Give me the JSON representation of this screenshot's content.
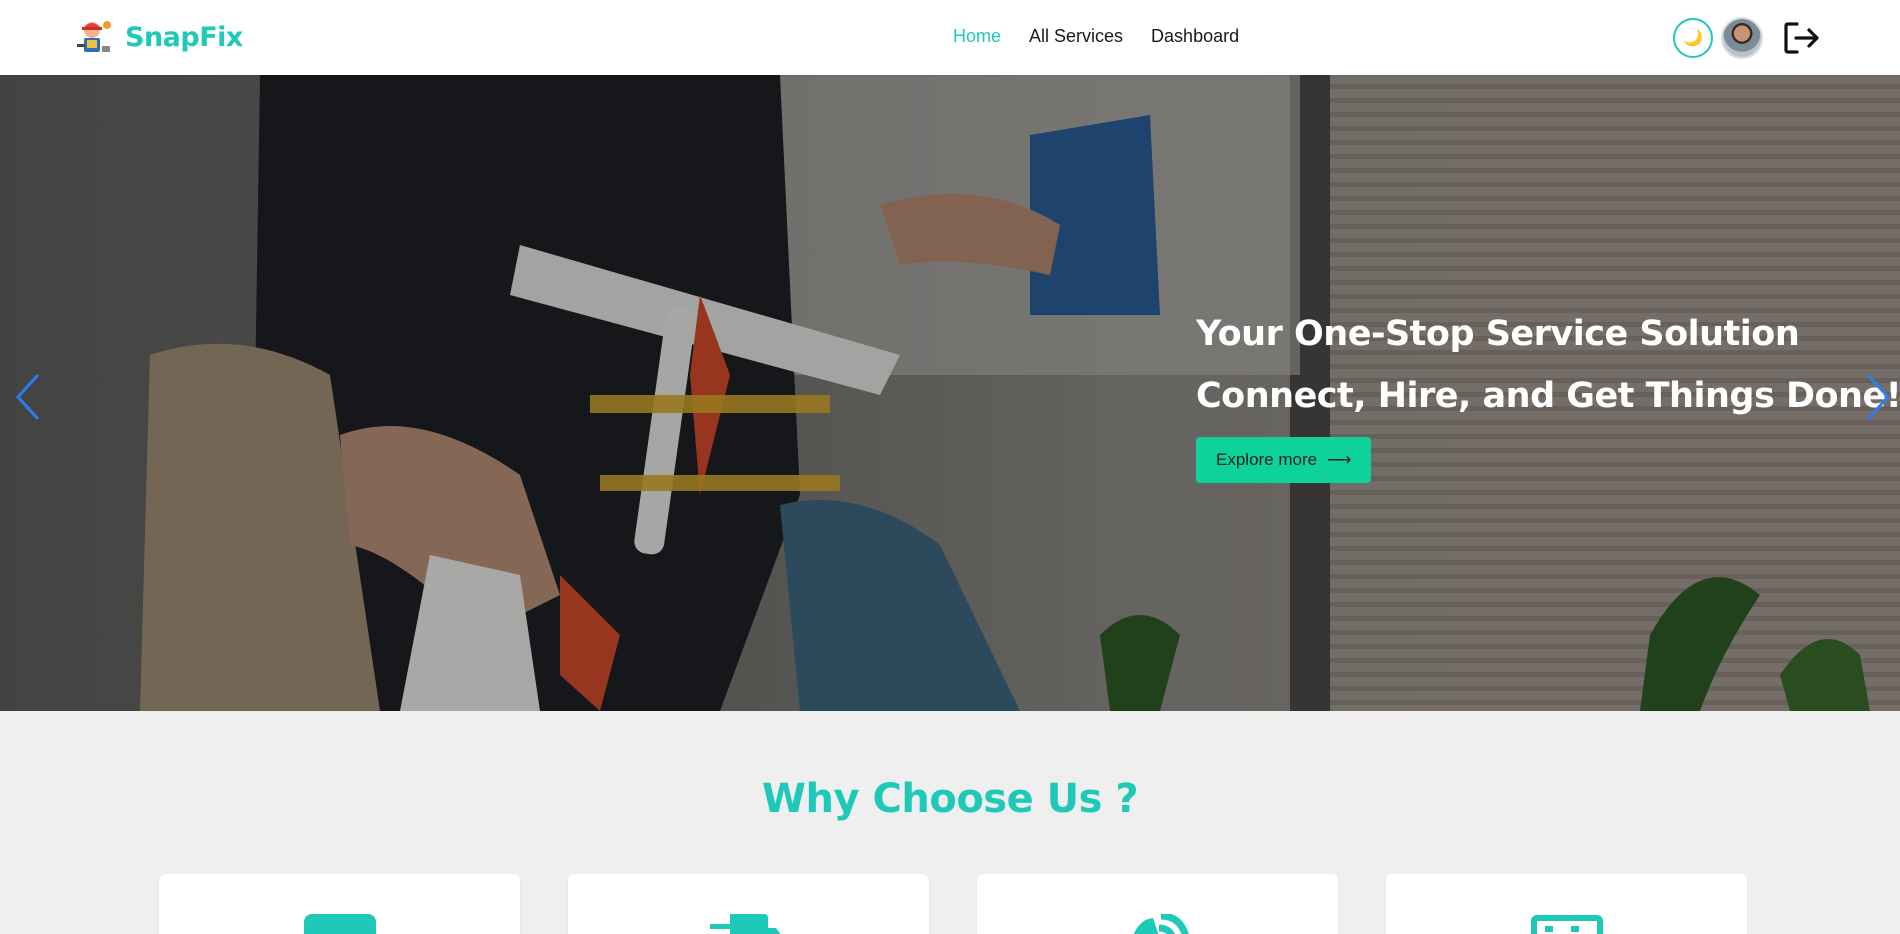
{
  "brand": {
    "name": "SnapFix",
    "accent": "#1ec9b7"
  },
  "nav": {
    "links": [
      {
        "label": "Home",
        "active": true
      },
      {
        "label": "All Services",
        "active": false
      },
      {
        "label": "Dashboard",
        "active": false
      }
    ],
    "theme_icon": "moon-icon",
    "theme_glyph": "🌙",
    "logout_icon": "logout-icon"
  },
  "hero": {
    "line1": "Your One-Stop Service Solution",
    "line2": "Connect, Hire, and Get Things Done!",
    "button_label": "Explore more",
    "button_icon": "arrow-right-icon",
    "button_glyph": "⟶",
    "button_color": "#0dd39a"
  },
  "why": {
    "title": "Why Choose Us ?",
    "cards": [
      {
        "icon": "card-icon"
      },
      {
        "icon": "truck-icon"
      },
      {
        "icon": "satellite-icon"
      },
      {
        "icon": "monitor-icon"
      }
    ]
  }
}
